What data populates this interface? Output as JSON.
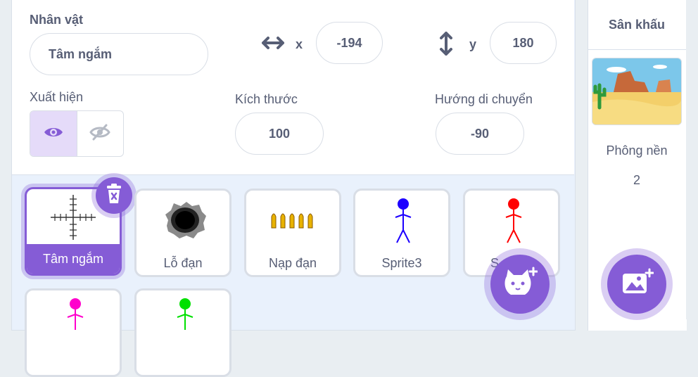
{
  "sprite_info": {
    "sprite_label": "Nhân vật",
    "sprite_name": "Tâm ngắm",
    "x_label": "x",
    "x_value": "-194",
    "y_label": "y",
    "y_value": "180",
    "show_label": "Xuất hiện",
    "size_label": "Kích thước",
    "size_value": "100",
    "direction_label": "Hướng di chuyển",
    "direction_value": "-90"
  },
  "sprites": [
    {
      "name": "Tâm ngắm",
      "selected": true
    },
    {
      "name": "Lỗ đạn"
    },
    {
      "name": "Nạp đạn"
    },
    {
      "name": "Sprite3"
    },
    {
      "name": "S"
    }
  ],
  "stage": {
    "title": "Sân khấu",
    "backdrops_label": "Phông nền",
    "backdrops_count": "2"
  },
  "colors": {
    "accent": "#855cd6",
    "text": "#575e75",
    "panel_bg": "#e9f1fc",
    "sprite3": "#1d00ff",
    "sprite_red": "#ff0000",
    "sprite_magenta": "#ff00cc",
    "sprite_green": "#00e000"
  },
  "icons": {
    "x_arrow": "horizontal-arrow-icon",
    "y_arrow": "vertical-arrow-icon",
    "show": "eye-icon",
    "hide": "eye-slash-icon",
    "delete": "trash-icon",
    "add_sprite": "cat-plus-icon",
    "add_backdrop": "image-plus-icon"
  }
}
